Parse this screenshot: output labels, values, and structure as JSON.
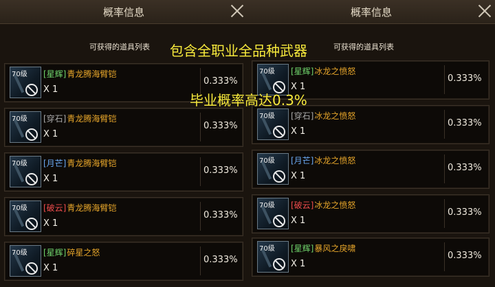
{
  "left_panel": {
    "title": "概率信息",
    "subtitle": "可获得的道具列表",
    "items": [
      {
        "level": "70级",
        "tag": "[星辉]",
        "tag_color": "#6fd36b",
        "name": "青龙腾海臂铠",
        "qty": "X 1",
        "pct": "0.333%"
      },
      {
        "level": "70级",
        "tag": "[穿石]",
        "tag_color": "#a8a8a8",
        "name": "青龙腾海臂铠",
        "qty": "X 1",
        "pct": "0.333%"
      },
      {
        "level": "70级",
        "tag": "[月芒]",
        "tag_color": "#6aa8f2",
        "name": "青龙腾海臂铠",
        "qty": "X 1",
        "pct": "0.333%"
      },
      {
        "level": "70级",
        "tag": "[破云]",
        "tag_color": "#ef4c4c",
        "name": "青龙腾海臂铠",
        "qty": "X 1",
        "pct": "0.333%"
      },
      {
        "level": "70级",
        "tag": "[星辉]",
        "tag_color": "#6fd36b",
        "name": "碎星之怒",
        "qty": "X 1",
        "pct": "0.333%"
      }
    ]
  },
  "right_panel": {
    "title": "概率信息",
    "subtitle": "可获得的道具列表",
    "items": [
      {
        "level": "70级",
        "tag": "[星辉]",
        "tag_color": "#6fd36b",
        "name": "冰龙之愤怒",
        "qty": "X 1",
        "pct": "0.333%"
      },
      {
        "level": "70级",
        "tag": "[穿石]",
        "tag_color": "#a8a8a8",
        "name": "冰龙之愤怒",
        "qty": "X 1",
        "pct": "0.333%"
      },
      {
        "level": "70级",
        "tag": "[月芒]",
        "tag_color": "#6aa8f2",
        "name": "冰龙之愤怒",
        "qty": "X 1",
        "pct": "0.333%"
      },
      {
        "level": "70级",
        "tag": "[破云]",
        "tag_color": "#ef4c4c",
        "name": "冰龙之愤怒",
        "qty": "X 1",
        "pct": "0.333%"
      },
      {
        "level": "70级",
        "tag": "[星辉]",
        "tag_color": "#6fd36b",
        "name": "暴风之戾啸",
        "qty": "X 1",
        "pct": "0.333%"
      }
    ]
  },
  "overlay": {
    "line1": "包含全职业全品种武器",
    "line2": "毕业概率高达0.3%"
  },
  "colors": {
    "item_name": "#e6a52a",
    "overlay": "#f8ea3c"
  },
  "icons": {
    "close": "close-icon",
    "forbidden": "no-trade-icon"
  }
}
